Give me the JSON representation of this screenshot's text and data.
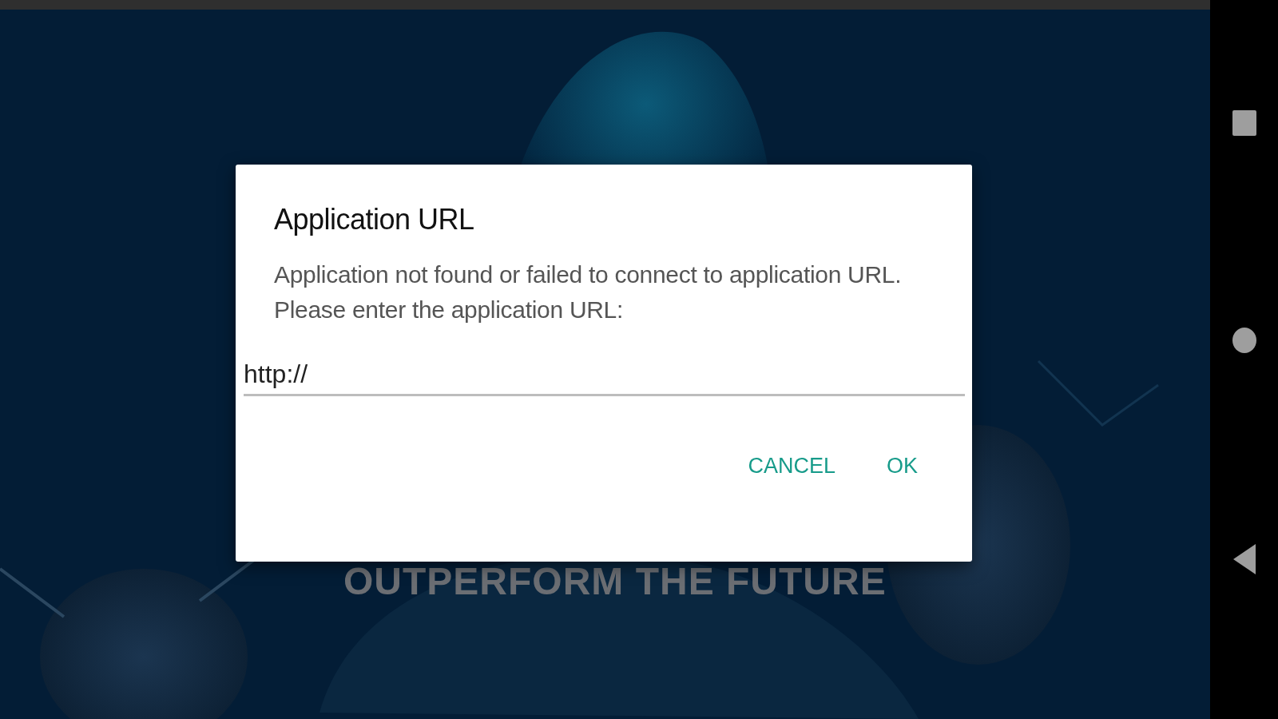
{
  "background": {
    "slogan": "OUTPERFORM THE FUTURE"
  },
  "dialog": {
    "title": "Application URL",
    "message": "Application not found or failed to connect to application URL.\nPlease enter the application URL:",
    "url_field": {
      "value": "http://"
    },
    "buttons": [
      {
        "label": "CANCEL"
      },
      {
        "label": "OK"
      }
    ]
  }
}
